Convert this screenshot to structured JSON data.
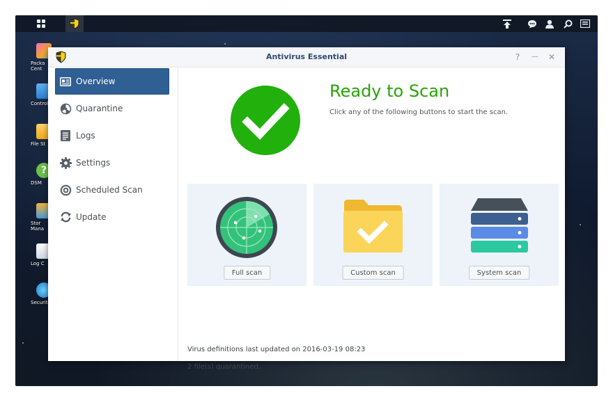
{
  "desktop": {
    "icons": [
      {
        "label": "Packa\nCent"
      },
      {
        "label": "Control"
      },
      {
        "label": "File St"
      },
      {
        "label": "DSM"
      },
      {
        "label": "Stor\nMana"
      },
      {
        "label": "Log C"
      },
      {
        "label": "Security"
      }
    ]
  },
  "window": {
    "title": "Antivirus Essential",
    "help_label": "?",
    "minimize_label": "—",
    "close_label": "✕"
  },
  "sidebar": {
    "items": [
      {
        "label": "Overview",
        "icon": "overview-icon",
        "active": true
      },
      {
        "label": "Quarantine",
        "icon": "radiation-icon",
        "active": false
      },
      {
        "label": "Logs",
        "icon": "log-icon",
        "active": false
      },
      {
        "label": "Settings",
        "icon": "gear-icon",
        "active": false
      },
      {
        "label": "Scheduled Scan",
        "icon": "target-icon",
        "active": false
      },
      {
        "label": "Update",
        "icon": "refresh-icon",
        "active": false
      }
    ]
  },
  "overview": {
    "status_title": "Ready to Scan",
    "status_subtitle": "Click any of the following buttons to start the scan.",
    "cards": [
      {
        "button_label": "Full scan",
        "icon": "radar-icon"
      },
      {
        "button_label": "Custom scan",
        "icon": "folder-check-icon"
      },
      {
        "button_label": "System scan",
        "icon": "server-stack-icon"
      }
    ],
    "definitions_text": "Virus definitions last updated on 2016-03-19 08:23",
    "quarantine_text": "2 file(s) quarantined."
  },
  "colors": {
    "accent": "#2f5f93",
    "success": "#2aa20a",
    "card_bg": "#edf3f9"
  }
}
